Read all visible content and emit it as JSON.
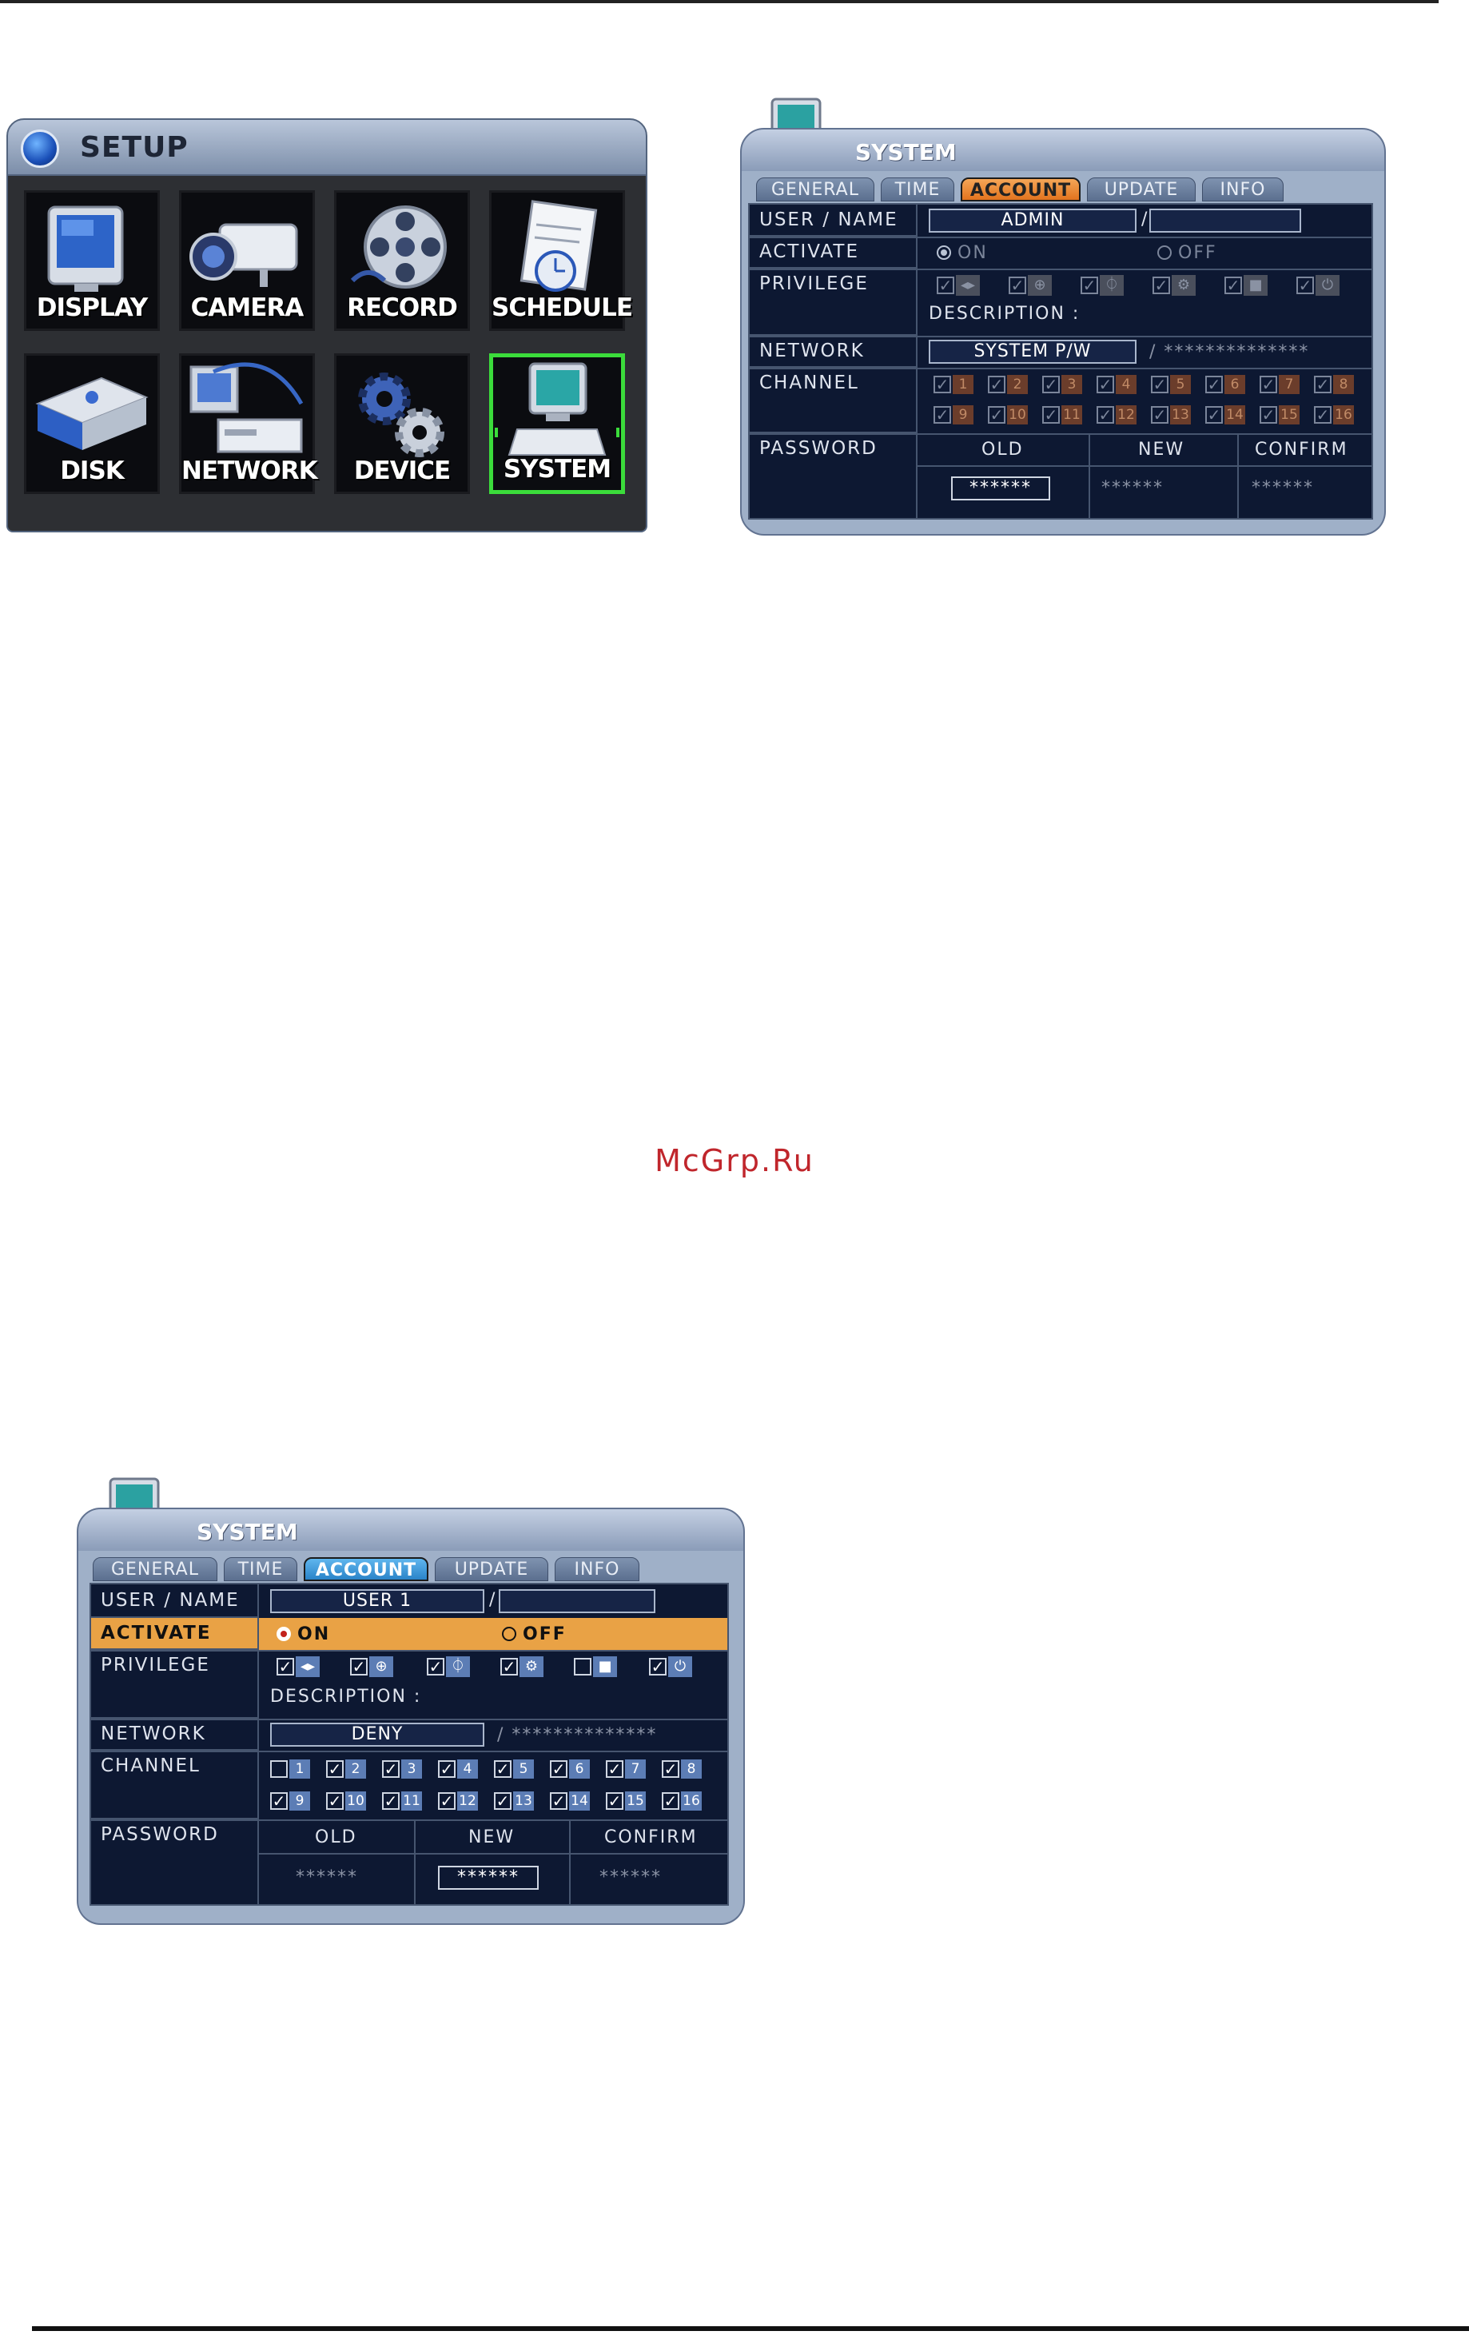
{
  "watermark": "McGrp.Ru",
  "setup": {
    "title": "SETUP",
    "tiles": [
      {
        "label": "DISPLAY",
        "icon": "monitor-icon"
      },
      {
        "label": "CAMERA",
        "icon": "camera-icon"
      },
      {
        "label": "RECORD",
        "icon": "film-reel-icon"
      },
      {
        "label": "SCHEDULE",
        "icon": "notepad-clock-icon"
      },
      {
        "label": "DISK",
        "icon": "disk-drive-icon"
      },
      {
        "label": "NETWORK",
        "icon": "network-icon"
      },
      {
        "label": "DEVICE",
        "icon": "gears-icon"
      },
      {
        "label": "SYSTEM",
        "icon": "computer-icon",
        "selected": true
      }
    ]
  },
  "system_admin": {
    "title": "SYSTEM",
    "tabs": [
      "GENERAL",
      "TIME",
      "ACCOUNT",
      "UPDATE",
      "INFO"
    ],
    "active_tab": "ACCOUNT",
    "labels": {
      "user_name": "USER / NAME",
      "activate": "ACTIVATE",
      "privilege": "PRIVILEGE",
      "network": "NETWORK",
      "channel": "CHANNEL",
      "password": "PASSWORD"
    },
    "user": "ADMIN",
    "name": "",
    "slash": "/",
    "activate_on": "ON",
    "activate_off": "OFF",
    "description": "DESCRIPTION :",
    "network_value": "SYSTEM P/W",
    "network_mask": "/ **************",
    "channels": [
      "1",
      "2",
      "3",
      "4",
      "5",
      "6",
      "7",
      "8",
      "9",
      "10",
      "11",
      "12",
      "13",
      "14",
      "15",
      "16"
    ],
    "password_headers": [
      "OLD",
      "NEW",
      "CONFIRM"
    ],
    "password_values": [
      "******",
      "******",
      "******"
    ]
  },
  "system_user": {
    "title": "SYSTEM",
    "tabs": [
      "GENERAL",
      "TIME",
      "ACCOUNT",
      "UPDATE",
      "INFO"
    ],
    "active_tab": "ACCOUNT",
    "labels": {
      "user_name": "USER / NAME",
      "activate": "ACTIVATE",
      "privilege": "PRIVILEGE",
      "network": "NETWORK",
      "channel": "CHANNEL",
      "password": "PASSWORD"
    },
    "user": "USER 1",
    "name": "",
    "slash": "/",
    "activate_on": "ON",
    "activate_off": "OFF",
    "description": "DESCRIPTION :",
    "network_value": "DENY",
    "network_mask": "/ **************",
    "channels": [
      "1",
      "2",
      "3",
      "4",
      "5",
      "6",
      "7",
      "8",
      "9",
      "10",
      "11",
      "12",
      "13",
      "14",
      "15",
      "16"
    ],
    "password_headers": [
      "OLD",
      "NEW",
      "CONFIRM"
    ],
    "password_values": [
      "******",
      "******",
      "******"
    ]
  },
  "colors": {
    "selected_tile_border": "#3bdc3b",
    "admin_tab_active": "#e2731e",
    "user_tab_active": "#2a83c8",
    "activate_highlight": "#e9a245"
  }
}
